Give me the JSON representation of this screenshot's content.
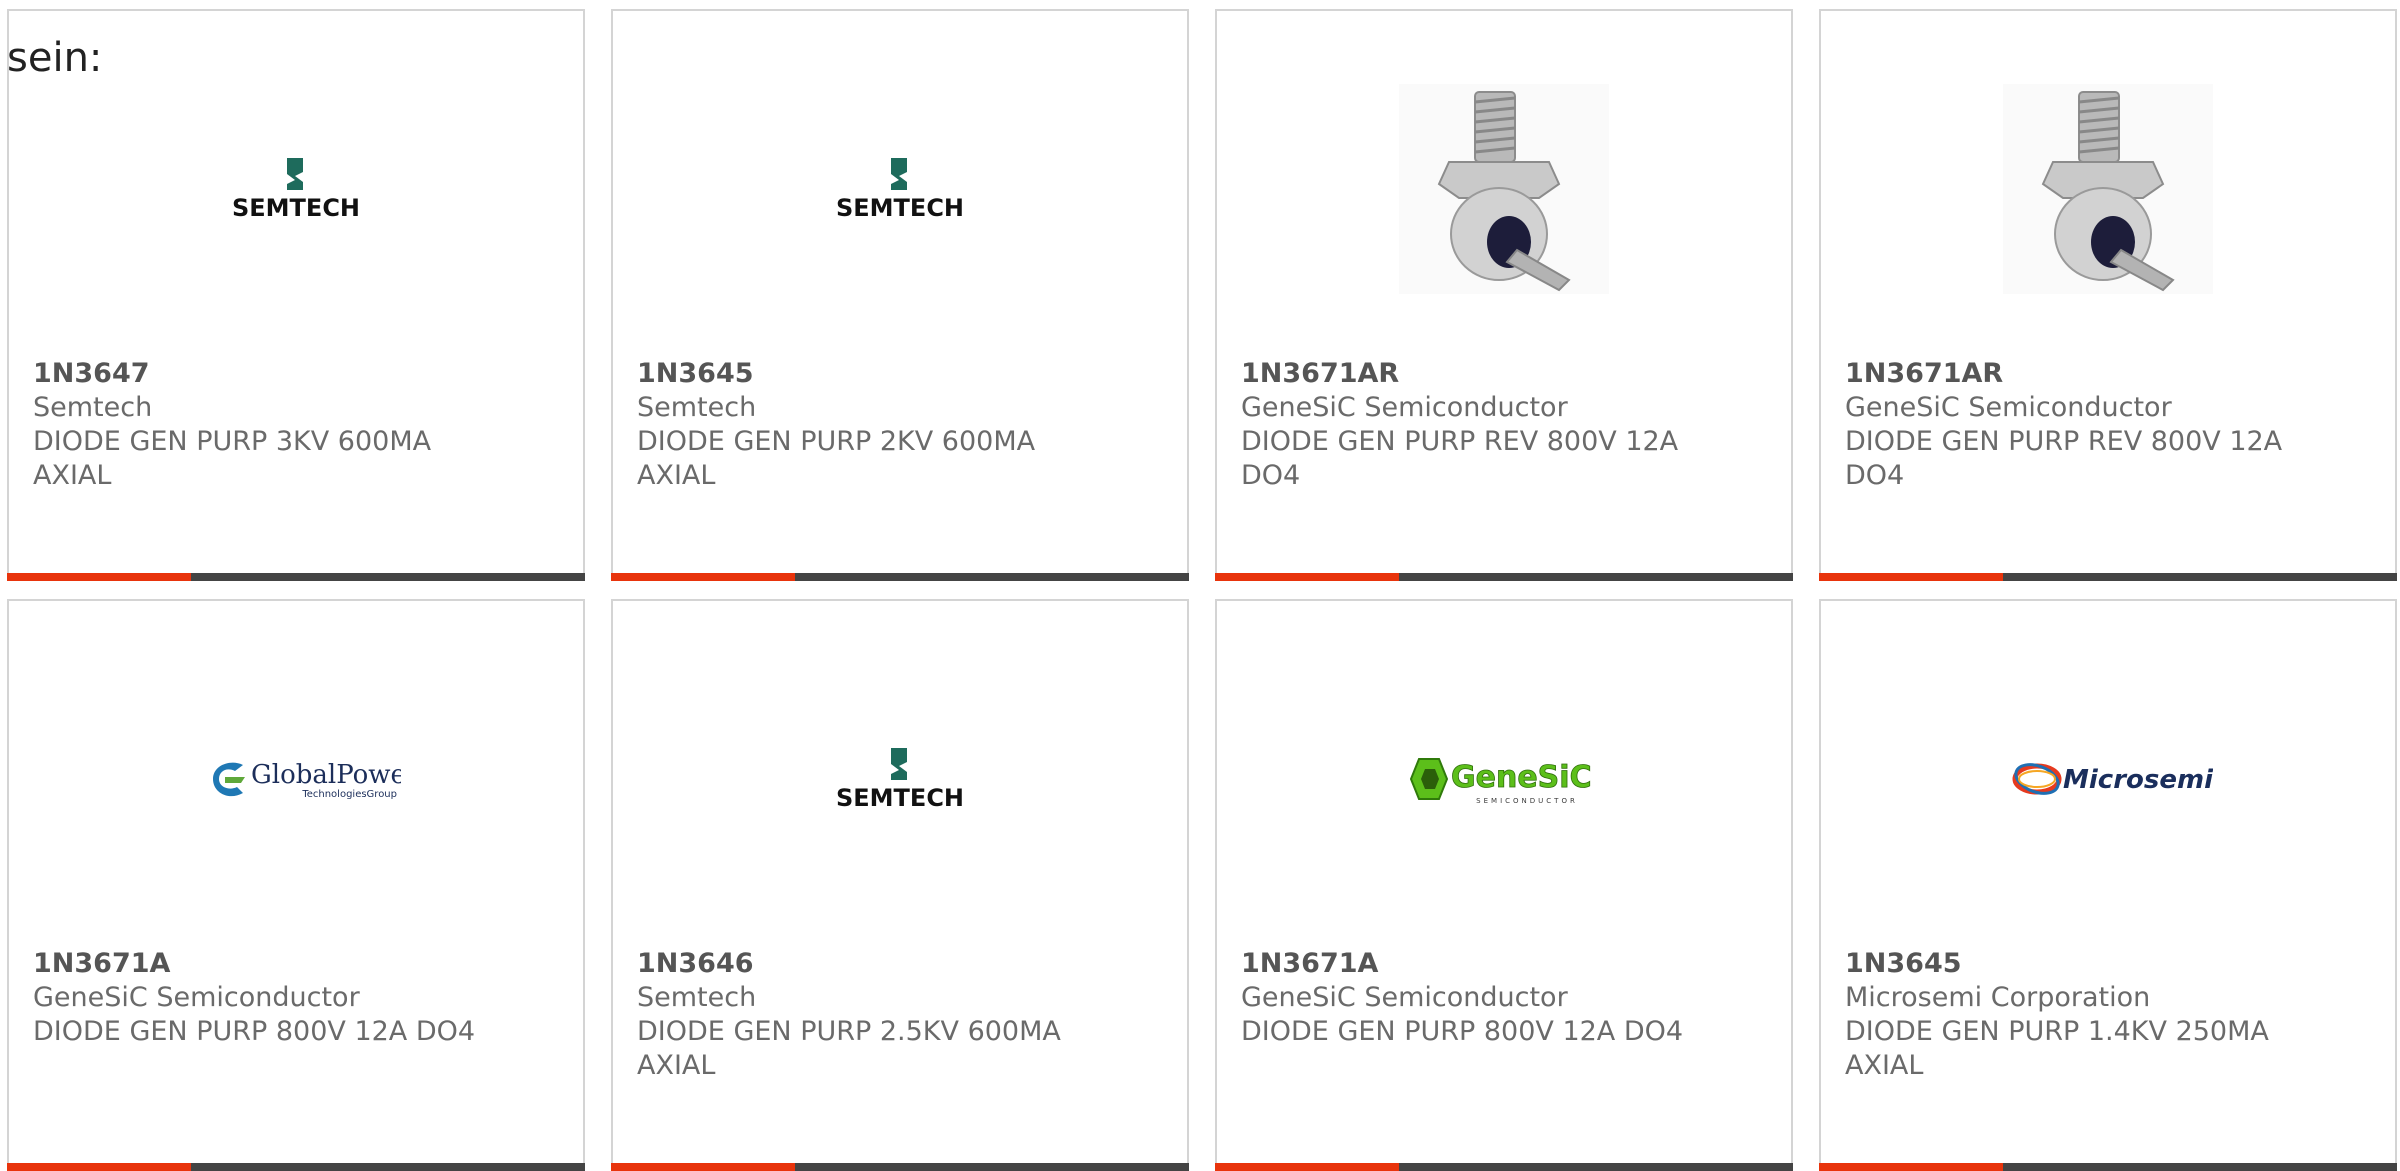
{
  "intro_text": "sein:",
  "colors": {
    "accent": "#e8340c",
    "bar": "#444444",
    "border": "#d4d4d4",
    "text": "#6a6a6a"
  },
  "products": [
    {
      "part": "1N3647",
      "maker": "Semtech",
      "desc": "DIODE GEN PURP 3KV 600MA",
      "desc2": "AXIAL",
      "image": "semtech-logo",
      "logo_text": "SEMTECH"
    },
    {
      "part": "1N3645",
      "maker": "Semtech",
      "desc": "DIODE GEN PURP 2KV 600MA",
      "desc2": "AXIAL",
      "image": "semtech-logo",
      "logo_text": "SEMTECH"
    },
    {
      "part": "1N3671AR",
      "maker": "GeneSiC Semiconductor",
      "desc": "DIODE GEN PURP REV 800V 12A",
      "desc2": "DO4",
      "image": "stud-diode-photo"
    },
    {
      "part": "1N3671AR",
      "maker": "GeneSiC Semiconductor",
      "desc": "DIODE GEN PURP REV 800V 12A",
      "desc2": "DO4",
      "image": "stud-diode-photo"
    },
    {
      "part": "1N3671A",
      "maker": "GeneSiC Semiconductor",
      "desc": "DIODE GEN PURP 800V 12A DO4",
      "desc2": "",
      "image": "globalpower-logo",
      "logo_text": "GlobalPower",
      "logo_sub": "TechnologiesGroup"
    },
    {
      "part": "1N3646",
      "maker": "Semtech",
      "desc": "DIODE GEN PURP 2.5KV 600MA",
      "desc2": "AXIAL",
      "image": "semtech-logo",
      "logo_text": "SEMTECH"
    },
    {
      "part": "1N3671A",
      "maker": "GeneSiC Semiconductor",
      "desc": "DIODE GEN PURP 800V 12A DO4",
      "desc2": "",
      "image": "genesic-logo",
      "logo_text": "GeneSiC",
      "logo_sub": "SEMICONDUCTOR"
    },
    {
      "part": "1N3645",
      "maker": "Microsemi Corporation",
      "desc": "DIODE GEN PURP 1.4KV 250MA",
      "desc2": "AXIAL",
      "image": "microsemi-logo",
      "logo_text": "Microsemi"
    }
  ]
}
